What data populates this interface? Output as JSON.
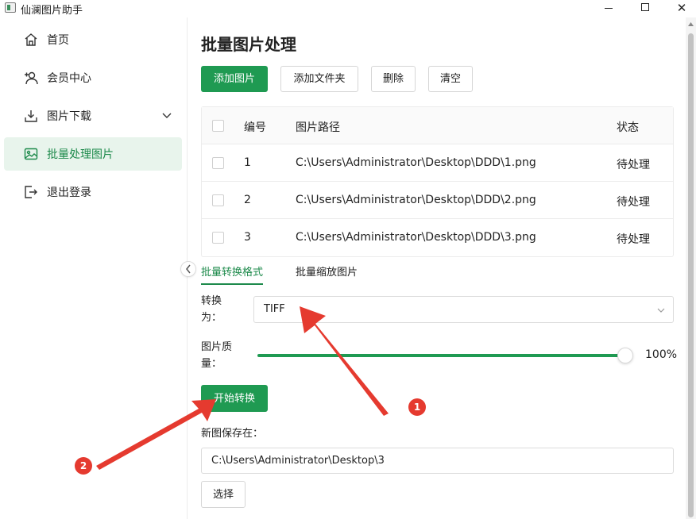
{
  "window": {
    "title": "仙澜图片助手"
  },
  "sidebar": {
    "items": [
      {
        "label": "首页",
        "icon": "home-icon"
      },
      {
        "label": "会员中心",
        "icon": "user-add-icon"
      },
      {
        "label": "图片下载",
        "icon": "download-icon"
      },
      {
        "label": "批量处理图片",
        "icon": "image-icon",
        "active": true
      },
      {
        "label": "退出登录",
        "icon": "logout-icon"
      }
    ]
  },
  "main": {
    "title": "批量图片处理",
    "toolbar": {
      "add_image": "添加图片",
      "add_folder": "添加文件夹",
      "delete": "删除",
      "clear": "清空"
    },
    "table": {
      "headers": [
        "编号",
        "图片路径",
        "状态"
      ],
      "rows": [
        {
          "num": "1",
          "path": "C:\\Users\\Administrator\\Desktop\\DDD\\1.png",
          "status": "待处理"
        },
        {
          "num": "2",
          "path": "C:\\Users\\Administrator\\Desktop\\DDD\\2.png",
          "status": "待处理"
        },
        {
          "num": "3",
          "path": "C:\\Users\\Administrator\\Desktop\\DDD\\3.png",
          "status": "待处理"
        }
      ]
    },
    "tabs": [
      {
        "label": "批量转换格式",
        "active": true
      },
      {
        "label": "批量缩放图片",
        "active": false
      }
    ],
    "convert": {
      "format_label_line1": "转换",
      "format_label_line2": "为：",
      "format_value": "TIFF",
      "quality_label_line1": "图片质",
      "quality_label_line2": "量：",
      "quality_value": "100%",
      "quality_fraction": 1.0,
      "start_button": "开始转换",
      "save_label": "新图保存在：",
      "save_path": "C:\\Users\\Administrator\\Desktop\\3",
      "choose_button": "选择"
    }
  },
  "annotations": {
    "badge_1": "1",
    "badge_2": "2"
  },
  "colors": {
    "accent": "#1f9a52",
    "active_bg": "#e8f4ec",
    "annotation": "#e53a2f"
  }
}
